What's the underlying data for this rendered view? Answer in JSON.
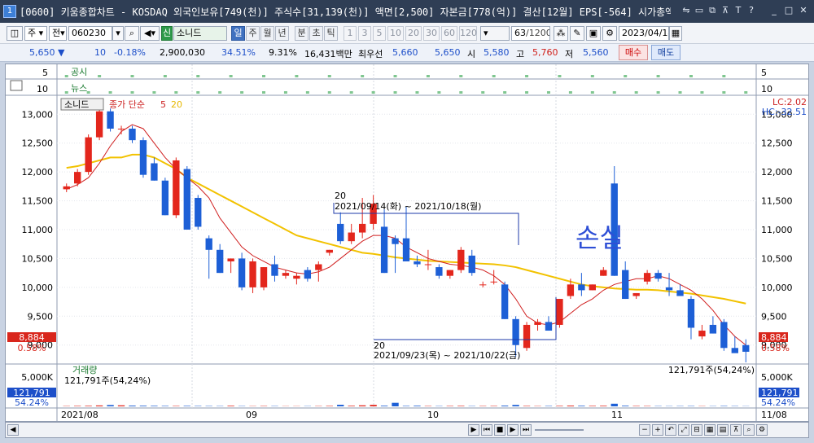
{
  "window": {
    "number": "1",
    "title": "[0600] 키움종합차트 - KOSDAQ 외국인보유[749(천)] 주식수[31,139(천)] 액면[2,500] 자본금[778(억)] 결산[12월] EPS[-564] 시가총액[1,759(억)]"
  },
  "toolbar": {
    "market": "주",
    "market2": "전",
    "code": "060230",
    "badge": "신",
    "stock_name": "소니드",
    "periods": [
      "일",
      "주",
      "월",
      "년",
      "분",
      "초",
      "틱"
    ],
    "active_period": "일",
    "intervals": [
      "1",
      "3",
      "5",
      "10",
      "20",
      "30",
      "60",
      "120"
    ],
    "count": "63",
    "count_total": "/1200",
    "date": "2023/04/14"
  },
  "quote": {
    "price": "5,650",
    "change": "10",
    "change_pct": "-0.18%",
    "volume": "2,900,030",
    "turnover": "34.51%",
    "foreign": "9.31%",
    "amount": "16,431백만",
    "best_ask_label": "최우선",
    "best_ask": "5,660",
    "best_bid": "5,650",
    "open_label": "시",
    "open": "5,580",
    "high_label": "고",
    "high": "5,760",
    "low_label": "저",
    "low": "5,560",
    "buy_label": "매수",
    "sell_label": "매도"
  },
  "panels": {
    "notice": {
      "label": "공시",
      "axis_left": "5",
      "axis_right": "5"
    },
    "news": {
      "label": "뉴스",
      "axis_left": "10",
      "axis_right": "10"
    },
    "price": {
      "stock_label": "소니드",
      "ma_label": "종가 단순",
      "ma_short": "5",
      "ma_long": "20",
      "lc": "LC:2.02",
      "hc": "HC:-32.51",
      "current": "8,884",
      "current_pct": "0.58%",
      "annotation": "손실",
      "range_top_count": "20",
      "range_top": "2021/09/14(화) ~ 2021/10/18(월)",
      "range_bottom_count": "20",
      "range_bottom": "2021/09/23(목) ~ 2021/10/22(금)"
    },
    "volume": {
      "label": "거래량",
      "info_left": "121,791주(54,24%)",
      "info_right": "121,791주(54,24%)",
      "axis": "5,000K",
      "current": "121,791",
      "current_pct": "54.24%"
    }
  },
  "x_labels": [
    "2021/08",
    "09",
    "10",
    "11",
    "11/08"
  ],
  "chart_data": {
    "type": "candlestick",
    "ylim": [
      8700,
      13300
    ],
    "yticks": [
      9000,
      9500,
      10000,
      10500,
      11000,
      11500,
      12000,
      12500,
      13000
    ],
    "ytick_labels": [
      "9,000",
      "9,500",
      "10,000",
      "10,500",
      "11,000",
      "11,500",
      "12,000",
      "12,500",
      "13,000"
    ],
    "candles": [
      [
        11700,
        11800,
        11650,
        11750
      ],
      [
        11800,
        12050,
        11750,
        12000
      ],
      [
        12000,
        12650,
        11950,
        12600
      ],
      [
        12600,
        13100,
        12550,
        13050
      ],
      [
        13050,
        13100,
        12700,
        12750
      ],
      [
        12750,
        12800,
        12650,
        12750
      ],
      [
        12750,
        12800,
        12500,
        12550
      ],
      [
        12550,
        12600,
        11900,
        11950
      ],
      [
        12150,
        12250,
        11850,
        11850
      ],
      [
        11850,
        11900,
        11250,
        11250
      ],
      [
        11250,
        12250,
        11200,
        12200
      ],
      [
        12050,
        12100,
        11000,
        11000
      ],
      [
        11550,
        11600,
        11000,
        11050
      ],
      [
        10850,
        10900,
        10150,
        10650
      ],
      [
        10650,
        10750,
        10250,
        10250
      ],
      [
        10450,
        10500,
        10250,
        10500
      ],
      [
        10500,
        10600,
        9950,
        10000
      ],
      [
        10000,
        10500,
        9900,
        10450
      ],
      [
        10000,
        10350,
        9950,
        10350
      ],
      [
        10400,
        10550,
        10100,
        10200
      ],
      [
        10200,
        10300,
        10150,
        10250
      ],
      [
        10150,
        10250,
        10050,
        10200
      ],
      [
        10300,
        10350,
        10100,
        10150
      ],
      [
        10300,
        10450,
        10100,
        10400
      ],
      [
        10600,
        10650,
        10550,
        10650
      ],
      [
        11100,
        11300,
        10750,
        10800
      ],
      [
        10800,
        11100,
        10750,
        10950
      ],
      [
        10950,
        11550,
        10850,
        11100
      ],
      [
        11100,
        11600,
        11000,
        11450
      ],
      [
        11050,
        11350,
        10250,
        10250
      ],
      [
        10850,
        10900,
        10250,
        10750
      ],
      [
        10850,
        11400,
        10550,
        10450
      ],
      [
        10450,
        10550,
        10350,
        10400
      ],
      [
        10400,
        10650,
        10300,
        10400
      ],
      [
        10350,
        10400,
        10150,
        10200
      ],
      [
        10200,
        10300,
        10150,
        10300
      ],
      [
        10300,
        10700,
        10250,
        10650
      ],
      [
        10550,
        10650,
        10200,
        10250
      ],
      [
        10050,
        10100,
        10000,
        10050
      ],
      [
        10100,
        10300,
        10050,
        10100
      ],
      [
        10050,
        10100,
        9450,
        9450
      ],
      [
        9450,
        9500,
        8800,
        9000
      ],
      [
        8950,
        9400,
        8900,
        9350
      ],
      [
        9350,
        9450,
        9250,
        9400
      ],
      [
        9400,
        9500,
        9250,
        9250
      ],
      [
        9350,
        9800,
        9300,
        9800
      ],
      [
        9850,
        10150,
        9800,
        10050
      ],
      [
        10050,
        10250,
        9850,
        9950
      ],
      [
        9950,
        10050,
        9950,
        10050
      ],
      [
        10200,
        10350,
        10200,
        10300
      ],
      [
        11800,
        12100,
        10200,
        10200
      ],
      [
        10300,
        10450,
        9800,
        9800
      ],
      [
        9850,
        9900,
        9800,
        9900
      ],
      [
        10100,
        10300,
        10050,
        10250
      ],
      [
        10250,
        10300,
        10100,
        10150
      ],
      [
        10000,
        10250,
        9850,
        9950
      ],
      [
        9950,
        10050,
        9900,
        9850
      ],
      [
        9800,
        9850,
        9100,
        9300
      ],
      [
        9150,
        9350,
        9100,
        9250
      ],
      [
        9350,
        9500,
        9200,
        9200
      ],
      [
        9400,
        9450,
        8900,
        8950
      ],
      [
        8950,
        9150,
        8900,
        8860
      ],
      [
        9000,
        9100,
        8700,
        8884
      ]
    ],
    "ma5": [
      11700,
      11780,
      11900,
      12150,
      12450,
      12700,
      12820,
      12750,
      12500,
      12250,
      12050,
      11900,
      11750,
      11550,
      11200,
      10950,
      10700,
      10550,
      10450,
      10350,
      10300,
      10250,
      10230,
      10270,
      10350,
      10500,
      10650,
      10800,
      10900,
      10900,
      10850,
      10700,
      10600,
      10500,
      10450,
      10400,
      10380,
      10350,
      10300,
      10200,
      10050,
      9800,
      9500,
      9380,
      9350,
      9400,
      9550,
      9700,
      9800,
      9950,
      10050,
      10100,
      10150,
      10150,
      10200,
      10150,
      10050,
      9950,
      9800,
      9600,
      9350,
      9150,
      9000
    ],
    "ma20": [
      12070,
      12100,
      12150,
      12200,
      12250,
      12250,
      12300,
      12300,
      12250,
      12150,
      12050,
      11900,
      11800,
      11700,
      11600,
      11500,
      11400,
      11300,
      11200,
      11100,
      11000,
      10900,
      10850,
      10800,
      10750,
      10700,
      10650,
      10600,
      10580,
      10550,
      10520,
      10500,
      10480,
      10460,
      10450,
      10440,
      10430,
      10420,
      10410,
      10400,
      10380,
      10350,
      10300,
      10250,
      10200,
      10150,
      10100,
      10050,
      10020,
      10000,
      9980,
      9970,
      9960,
      9960,
      9950,
      9930,
      9910,
      9890,
      9860,
      9830,
      9800,
      9760,
      9720
    ],
    "volume": [
      60,
      90,
      110,
      180,
      260,
      200,
      150,
      130,
      110,
      90,
      80,
      100,
      80,
      70,
      60,
      120,
      60,
      50,
      70,
      60,
      40,
      40,
      50,
      60,
      90,
      310,
      120,
      200,
      290,
      130,
      700,
      90,
      130,
      70,
      60,
      80,
      100,
      60,
      70,
      80,
      150,
      280,
      90,
      60,
      80,
      100,
      150,
      120,
      100,
      120,
      520,
      130,
      80,
      70,
      60,
      50,
      60,
      70,
      50,
      50,
      80,
      60,
      40
    ],
    "vol_max": 6500
  }
}
